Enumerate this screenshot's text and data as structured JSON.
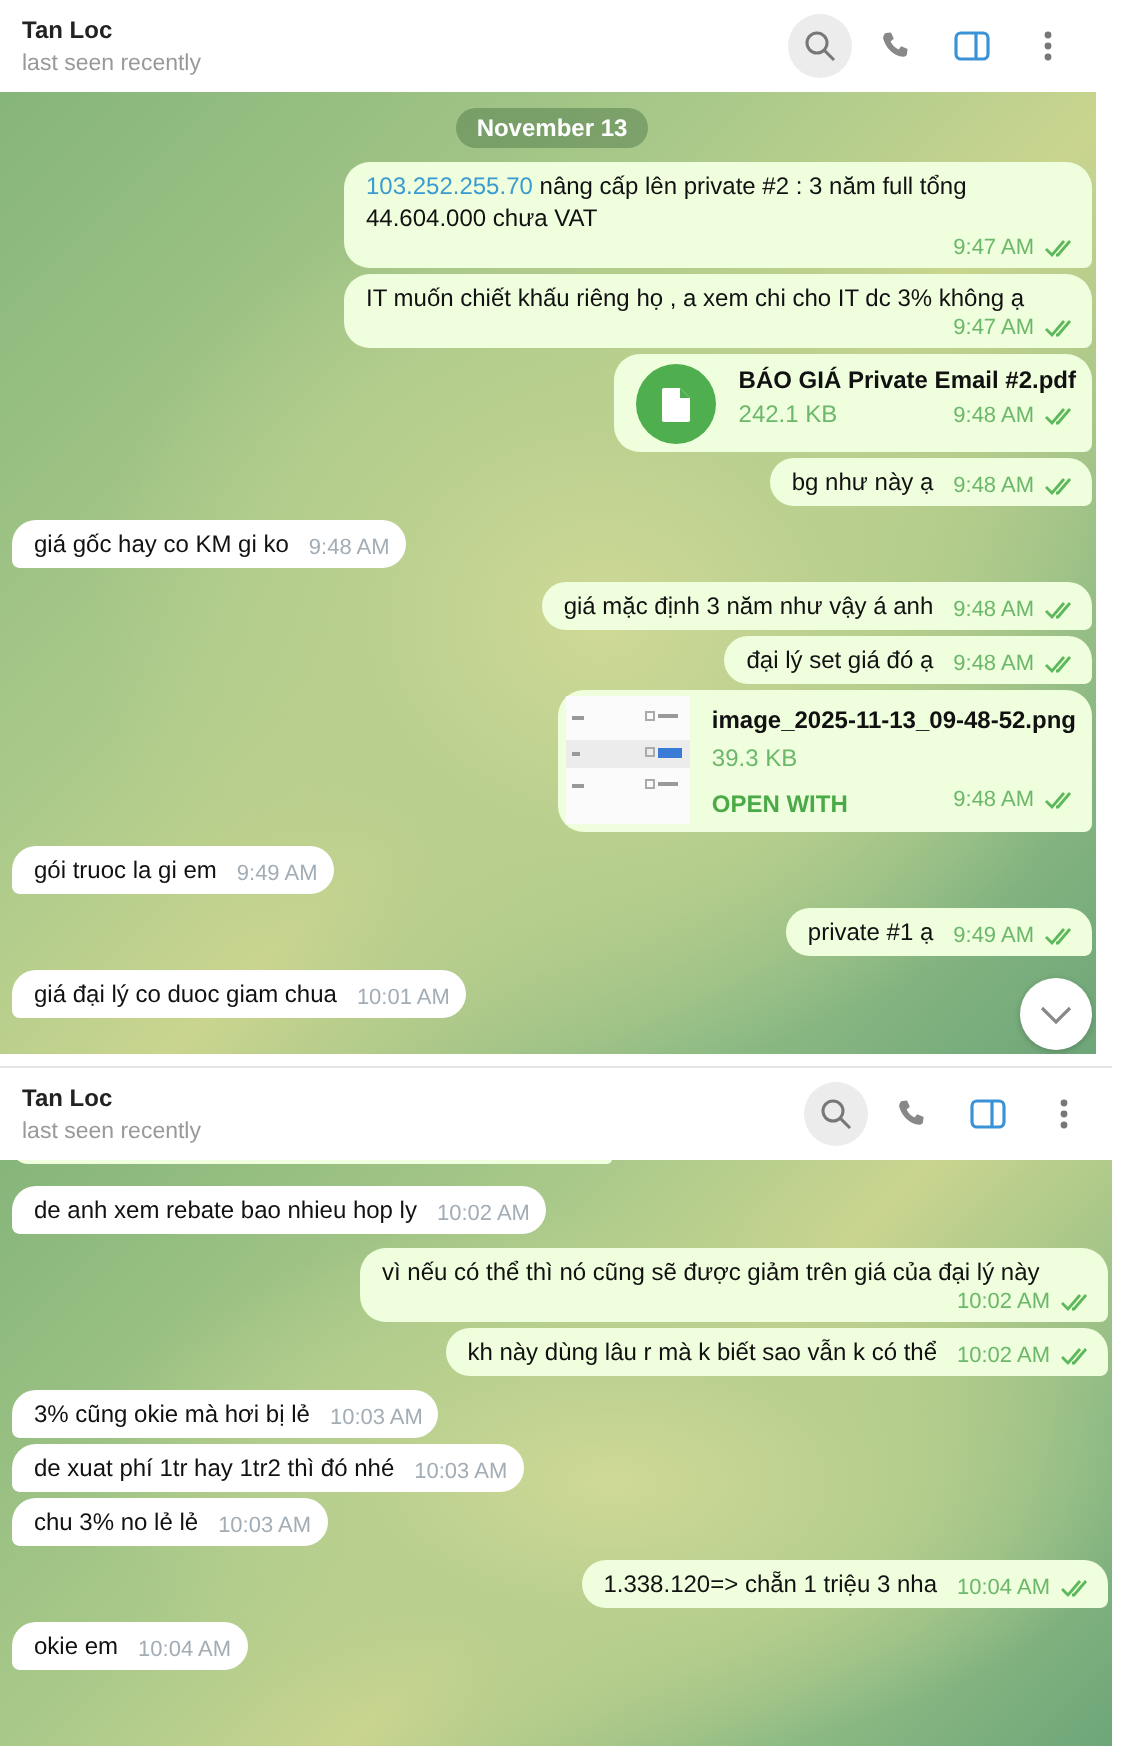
{
  "panels": [
    {
      "header": {
        "name": "Tan Loc",
        "status": "last seen recently",
        "side_panel_open": true
      },
      "date": "November 13",
      "scroll_down_button": true,
      "messages": [
        {
          "kind": "text",
          "outgoing": true,
          "link": "103.252.255.70",
          "text": "nâng cấp lên private #2 : 3 năm full tổng 44.604.000 chưa VAT",
          "time": "9:47 AM",
          "read": true
        },
        {
          "kind": "text",
          "outgoing": true,
          "text": "IT muốn chiết khấu riêng họ , a xem chi cho IT dc 3% không ạ",
          "time": "9:47 AM",
          "read": true
        },
        {
          "kind": "file",
          "outgoing": true,
          "name": "BÁO GIÁ Private Email #2.pdf",
          "size": "242.1 KB",
          "time": "9:48 AM",
          "read": true
        },
        {
          "kind": "text",
          "outgoing": true,
          "text": "bg như này ạ",
          "time": "9:48 AM",
          "read": true
        },
        {
          "kind": "text",
          "outgoing": false,
          "text": "giá gốc hay co KM gi ko",
          "time": "9:48 AM"
        },
        {
          "kind": "text",
          "outgoing": true,
          "text": "giá mặc định 3 năm như vậy á anh",
          "time": "9:48 AM",
          "read": true
        },
        {
          "kind": "text",
          "outgoing": true,
          "text": "đại lý set giá đó ạ",
          "time": "9:48 AM",
          "read": true
        },
        {
          "kind": "image",
          "outgoing": true,
          "name": "image_2025-11-13_09-48-52.png",
          "size": "39.3 KB",
          "action": "OPEN WITH",
          "time": "9:48 AM",
          "read": true
        },
        {
          "kind": "text",
          "outgoing": false,
          "text": "gói truoc la gi em",
          "time": "9:49 AM"
        },
        {
          "kind": "text",
          "outgoing": true,
          "text": "private #1 ạ",
          "time": "9:49 AM",
          "read": true
        },
        {
          "kind": "text",
          "outgoing": false,
          "text": "giá đại lý co duoc giam chua",
          "time": "10:01 AM"
        }
      ]
    },
    {
      "header": {
        "name": "Tan Loc",
        "status": "last seen recently",
        "side_panel_open": true
      },
      "messages": [
        {
          "kind": "text",
          "outgoing": false,
          "text": "de anh xem rebate bao nhieu hop ly",
          "time": "10:02 AM"
        },
        {
          "kind": "text",
          "outgoing": true,
          "text": "vì nếu có thể thì nó cũng sẽ được giảm trên giá của đại lý này",
          "time": "10:02 AM",
          "read": true
        },
        {
          "kind": "text",
          "outgoing": true,
          "text": "kh này dùng lâu r mà k biết sao vẫn k có thể",
          "time": "10:02 AM",
          "read": true
        },
        {
          "kind": "text",
          "outgoing": false,
          "text": "3% cũng okie mà hơi bị lẻ",
          "time": "10:03 AM"
        },
        {
          "kind": "text",
          "outgoing": false,
          "text": "de xuat phí 1tr hay 1tr2 thì đó nhé",
          "time": "10:03 AM"
        },
        {
          "kind": "text",
          "outgoing": false,
          "text": "chu 3% no lẻ lẻ",
          "time": "10:03 AM"
        },
        {
          "kind": "text",
          "outgoing": true,
          "text": "1.338.120=> chẵn 1 triệu 3 nha",
          "time": "10:04 AM",
          "read": true
        },
        {
          "kind": "text",
          "outgoing": false,
          "text": "okie em",
          "time": "10:04 AM"
        }
      ]
    }
  ]
}
